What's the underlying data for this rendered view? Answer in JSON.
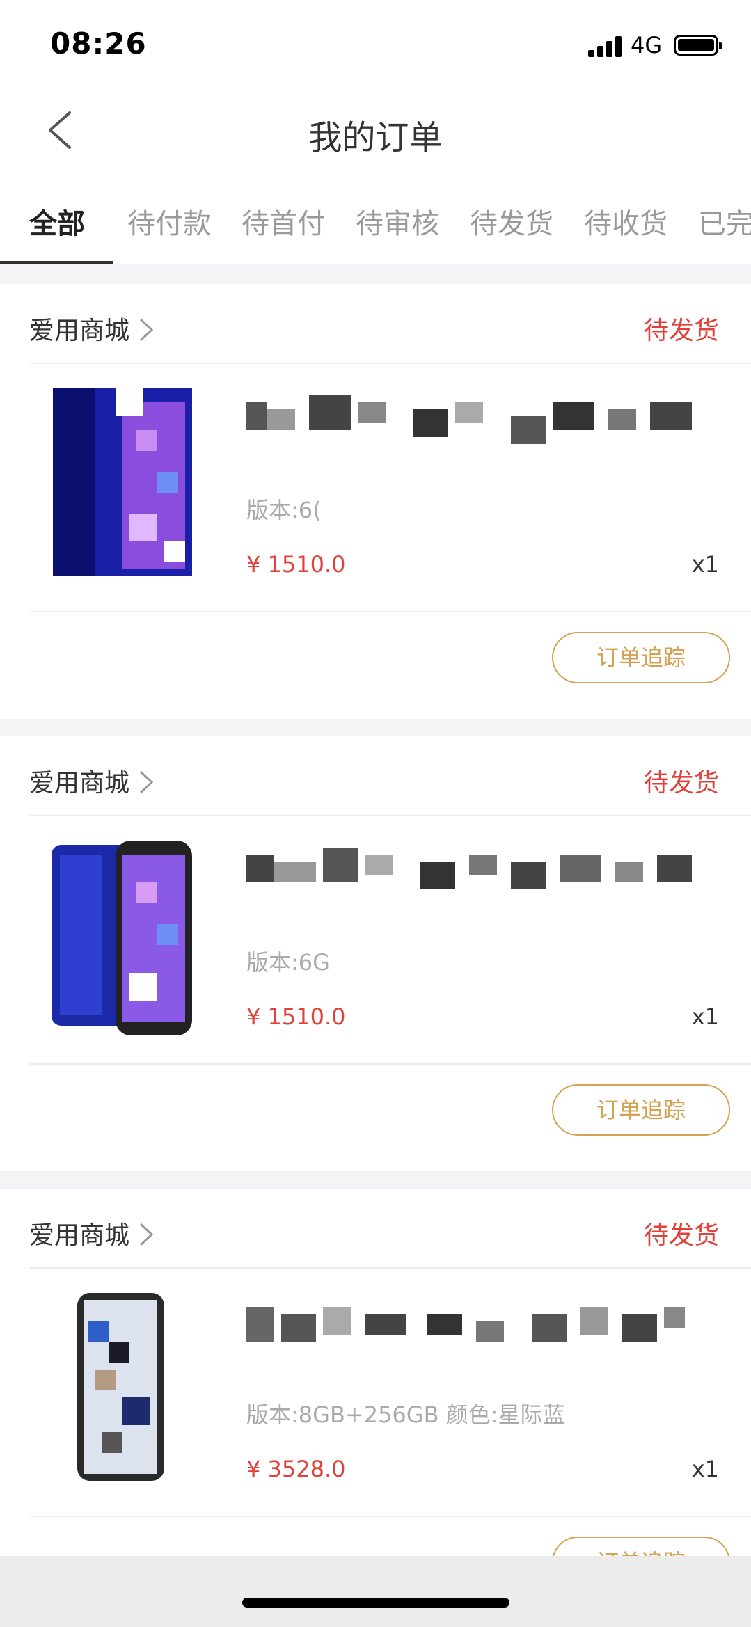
{
  "status_bar": {
    "time": "08:26",
    "network": "4G"
  },
  "nav": {
    "title": "我的订单",
    "back_icon": "chevron-left-icon"
  },
  "tabs": [
    {
      "label": "全部",
      "active": true
    },
    {
      "label": "待付款",
      "active": false
    },
    {
      "label": "待首付",
      "active": false
    },
    {
      "label": "待审核",
      "active": false
    },
    {
      "label": "待发货",
      "active": false
    },
    {
      "label": "待收货",
      "active": false
    },
    {
      "label": "已完",
      "active": false
    }
  ],
  "orders": [
    {
      "store": "爱用商城",
      "status": "待发货",
      "version": "版本:6(",
      "price": "¥ 1510.0",
      "qty": "x1",
      "action": "订单追踪"
    },
    {
      "store": "爱用商城",
      "status": "待发货",
      "version": "版本:6G",
      "price": "¥ 1510.0",
      "qty": "x1",
      "action": "订单追踪"
    },
    {
      "store": "爱用商城",
      "status": "待发货",
      "version": "版本:8GB+256GB  颜色:星际蓝",
      "price": "¥ 3528.0",
      "qty": "x1",
      "action": "订单追踪"
    }
  ],
  "colors": {
    "accent_red": "#e0413b",
    "button_gold": "#d4a252",
    "background": "#f4f4f7"
  }
}
